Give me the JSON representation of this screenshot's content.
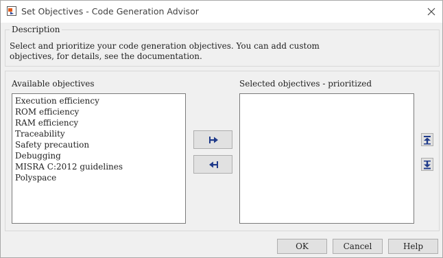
{
  "window": {
    "title": "Set Objectives - Code Generation Advisor",
    "icons": [
      "simulink-app-icon",
      "close-icon"
    ]
  },
  "description": {
    "legend": "Description",
    "text": "Select and prioritize your code generation objectives. You can add custom\nobjectives, for details, see the documentation."
  },
  "available": {
    "label": "Available objectives",
    "items": [
      "Execution efficiency",
      "ROM efficiency",
      "RAM efficiency",
      "Traceability",
      "Safety precaution",
      "Debugging",
      "MISRA C:2012 guidelines",
      "Polyspace"
    ]
  },
  "selected": {
    "label": "Selected objectives - prioritized",
    "items": []
  },
  "move_buttons": [
    "add-right-arrow-icon",
    "remove-left-arrow-icon"
  ],
  "priority_buttons": [
    "move-to-top-icon",
    "move-to-bottom-icon"
  ],
  "footer": {
    "ok": "OK",
    "cancel": "Cancel",
    "help": "Help"
  }
}
